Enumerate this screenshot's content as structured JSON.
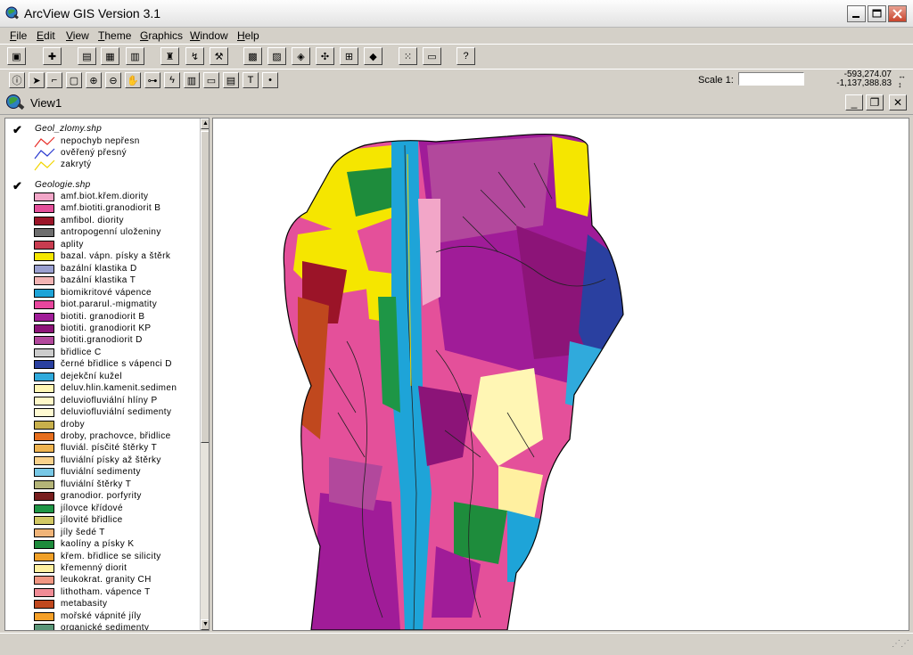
{
  "app": {
    "title": "ArcView GIS Version 3.1"
  },
  "menu": [
    "File",
    "Edit",
    "View",
    "Theme",
    "Graphics",
    "Window",
    "Help"
  ],
  "toolbar1": [
    {
      "icon": "save-icon",
      "glyph": "▣"
    },
    {
      "icon": "add-theme-icon",
      "glyph": "✚"
    },
    {
      "icon": "theme-properties-icon",
      "glyph": "▤"
    },
    {
      "icon": "edit-legend-icon",
      "glyph": "▦"
    },
    {
      "icon": "open-table-icon",
      "glyph": "▥"
    },
    {
      "icon": "find-icon",
      "glyph": "♜"
    },
    {
      "icon": "locate-address-icon",
      "glyph": "↯"
    },
    {
      "icon": "query-builder-icon",
      "glyph": "⚒"
    },
    {
      "icon": "select-by-theme-icon",
      "glyph": "▩"
    },
    {
      "icon": "clear-selection-icon",
      "glyph": "▨"
    },
    {
      "icon": "zoom-to-active-icon",
      "glyph": "◈"
    },
    {
      "icon": "zoom-full-extent-icon",
      "glyph": "✣"
    },
    {
      "icon": "zoom-to-selected-icon",
      "glyph": "⊞"
    },
    {
      "icon": "zoom-previous-icon",
      "glyph": "◆"
    },
    {
      "icon": "layout-icon",
      "glyph": "⁙"
    },
    {
      "icon": "print-icon",
      "glyph": "▭"
    },
    {
      "icon": "help-icon",
      "glyph": "?"
    }
  ],
  "toolbar2": [
    {
      "icon": "identify-icon",
      "glyph": "ⓘ"
    },
    {
      "icon": "pointer-icon",
      "glyph": "➤"
    },
    {
      "icon": "vertex-edit-icon",
      "glyph": "⌐"
    },
    {
      "icon": "select-feature-icon",
      "glyph": "▢"
    },
    {
      "icon": "zoom-in-icon",
      "glyph": "⊕"
    },
    {
      "icon": "zoom-out-icon",
      "glyph": "⊖"
    },
    {
      "icon": "pan-icon",
      "glyph": "✋"
    },
    {
      "icon": "measure-icon",
      "glyph": "⊶"
    },
    {
      "icon": "hotlink-icon",
      "glyph": "ϟ"
    },
    {
      "icon": "area-of-interest-icon",
      "glyph": "▥"
    },
    {
      "icon": "label-icon",
      "glyph": "▭"
    },
    {
      "icon": "callout-icon",
      "glyph": "▤"
    },
    {
      "icon": "text-icon",
      "glyph": "T"
    },
    {
      "icon": "draw-point-icon",
      "glyph": "•"
    }
  ],
  "scale": {
    "label": "Scale 1:",
    "value": ""
  },
  "coords": {
    "x": "-593,274.07",
    "y": "-1,137,388.83"
  },
  "view": {
    "title": "View1"
  },
  "toc": {
    "line_theme": {
      "name": "Geol_zlomy.shp",
      "items": [
        {
          "label": "nepochyb nepřesn",
          "color": "#e8302a"
        },
        {
          "label": "ověřený přesný",
          "color": "#2a3ad0"
        },
        {
          "label": "zakrytý",
          "color": "#f2d500"
        }
      ]
    },
    "poly_theme": {
      "name": "Geologie.shp",
      "items": [
        {
          "label": "amf.biot.křem.diority",
          "color": "#f2a6c8"
        },
        {
          "label": "amf.biotiti.granodiorit B",
          "color": "#e4509a"
        },
        {
          "label": "amfibol. diority",
          "color": "#9b1428"
        },
        {
          "label": "antropogenní uloženiny",
          "color": "#6e6e6e"
        },
        {
          "label": "aplity",
          "color": "#c83c50"
        },
        {
          "label": "bazal. vápn. písky a štěrk",
          "color": "#f5e600"
        },
        {
          "label": "bazální klastika D",
          "color": "#9aa0d0"
        },
        {
          "label": "bazální klastika T",
          "color": "#f2b4b4"
        },
        {
          "label": "biomikritové vápence",
          "color": "#1ea4d8"
        },
        {
          "label": "biot.pararul.-migmatity",
          "color": "#e8469e"
        },
        {
          "label": "biotiti. granodiorit B",
          "color": "#a01c98"
        },
        {
          "label": "biotiti. granodiorit KP",
          "color": "#8c1478"
        },
        {
          "label": "biotiti.granodiorit D",
          "color": "#b2489c"
        },
        {
          "label": "břidlice C",
          "color": "#cccccc"
        },
        {
          "label": "černé břidlice s vápenci D",
          "color": "#2a40a0"
        },
        {
          "label": "dejekční kužel",
          "color": "#30aadc"
        },
        {
          "label": "deluv.hlin.kamenit.sedimen",
          "color": "#fff6b4"
        },
        {
          "label": "deluviofluviální hlíny P",
          "color": "#fff8c8"
        },
        {
          "label": "deluviofluviální sedimenty",
          "color": "#fffad2"
        },
        {
          "label": "droby",
          "color": "#c8b04c"
        },
        {
          "label": "droby, prachovce, břidlice",
          "color": "#e66e1e"
        },
        {
          "label": "fluviál. písčité štěrky T",
          "color": "#f0b450"
        },
        {
          "label": "fluviální písky až štěrky",
          "color": "#fad28c"
        },
        {
          "label": "fluviální sedimenty",
          "color": "#78c8e6"
        },
        {
          "label": "fluviální štěrky T",
          "color": "#b4b478"
        },
        {
          "label": "granodior. porfyrity",
          "color": "#781e1e"
        },
        {
          "label": "jílovce křídové",
          "color": "#1e9646"
        },
        {
          "label": "jílovité břidlice",
          "color": "#d2c864"
        },
        {
          "label": "jíly šedé T",
          "color": "#f0b478"
        },
        {
          "label": "kaolíny a písky K",
          "color": "#1e8c3c"
        },
        {
          "label": "křem. břidlice se silicity",
          "color": "#f0a028"
        },
        {
          "label": "křemenný diorit",
          "color": "#fff0a0"
        },
        {
          "label": "leukokrat. granity CH",
          "color": "#f09682"
        },
        {
          "label": "lithotham. vápence T",
          "color": "#f08c96"
        },
        {
          "label": "metabasity",
          "color": "#c0481e"
        },
        {
          "label": "mořské vápnité jíly",
          "color": "#f5a028"
        },
        {
          "label": "organické sedimenty",
          "color": "#5a9678"
        }
      ]
    }
  }
}
